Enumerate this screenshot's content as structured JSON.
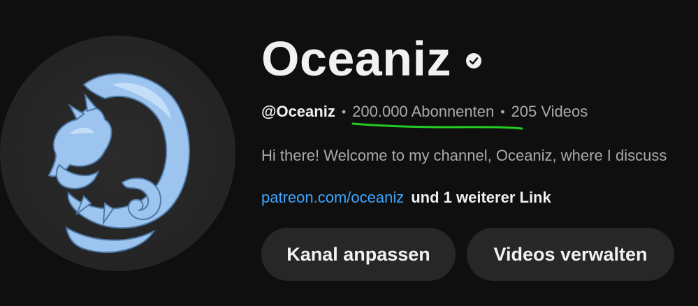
{
  "channel": {
    "title": "Oceaniz",
    "handle": "@Oceaniz",
    "subscribers": "200.000 Abonnenten",
    "videos": "205 Videos",
    "separator": "•",
    "description": "Hi there! Welcome to my channel, Oceaniz, where I discuss",
    "link_text": "patreon.com/oceaniz",
    "more_links": "und 1 weiterer Link"
  },
  "buttons": {
    "customize": "Kanal anpassen",
    "manage": "Videos verwalten"
  },
  "icons": {
    "verified": "verified-check-icon",
    "avatar": "blue-dragon-logo"
  },
  "colors": {
    "background": "#0f0f0f",
    "link": "#3ea6ff",
    "secondary_text": "#aaaaaa",
    "button_bg": "#272727",
    "highlight_underline": "#22cc22",
    "avatar_blue": "#9cc4ee"
  }
}
